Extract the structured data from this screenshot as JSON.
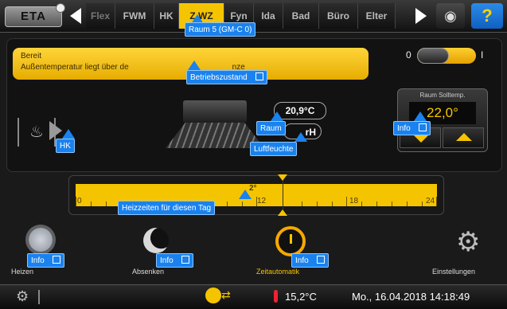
{
  "header": {
    "logo": "ETA",
    "tabs": [
      {
        "label": "Flex",
        "active": false
      },
      {
        "label": "FWM",
        "active": false
      },
      {
        "label": "HK",
        "active": false
      },
      {
        "label": "Z.WZ",
        "active": true
      },
      {
        "label": "Fyn",
        "active": false
      },
      {
        "label": "Ida",
        "active": false
      },
      {
        "label": "Bad",
        "active": false
      },
      {
        "label": "Büro",
        "active": false
      },
      {
        "label": "Elter",
        "active": false
      }
    ],
    "help_label": "?"
  },
  "status": {
    "line1": "Bereit",
    "line2": "Außentemperatur liegt über de",
    "line2_tail": "nze"
  },
  "switch": {
    "off_label": "0",
    "on_label": "I"
  },
  "readings": {
    "room_temp": "20,9°C",
    "humidity": "rH"
  },
  "setpoint": {
    "title": "Raum Solltemp.",
    "value": "22,0°"
  },
  "timeline": {
    "labels": [
      "0",
      "12",
      "18",
      "24"
    ],
    "partial_label": "2°"
  },
  "modes": [
    {
      "label": "Heizen",
      "active": false
    },
    {
      "label": "Absenken",
      "active": false
    },
    {
      "label": "Zeitautomatik",
      "active": true
    },
    {
      "label": "Einstellungen",
      "active": false
    }
  ],
  "statusbar": {
    "temperature": "15,2°C",
    "datetime": "Mo., 16.04.2018 14:18:49"
  },
  "tooltips": {
    "raum5": "Raum 5 (GM-C 0)",
    "betrieb": "Betriebszustand",
    "raum": "Raum",
    "luftfeuchte": "Luftfeuchte",
    "hk": "HK",
    "info": "Info",
    "heizzeiten": "Heizzeiten für diesen Tag"
  },
  "colors": {
    "accent": "#f5c400",
    "tooltip": "#1a82ee"
  }
}
